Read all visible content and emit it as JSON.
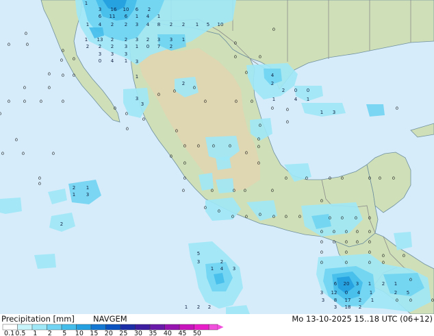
{
  "map": {
    "colors": {
      "sea": "#d6ecfa",
      "land": "#cfe0b8",
      "highland": "#e2d4b0",
      "border": "#8a8a8a",
      "coast": "#6f8f9f"
    },
    "cell_values": [
      [
        "1",
        "3",
        "16",
        "10",
        "6",
        "2"
      ],
      [
        "6",
        "11",
        "6",
        "1",
        "4",
        "1"
      ],
      [
        "1",
        "4",
        "2",
        "2",
        "3",
        "4",
        "8",
        "2",
        "2",
        "1",
        "5",
        "10"
      ],
      [
        "1",
        "13",
        "2",
        "2",
        "3",
        "2",
        "3",
        "3",
        "1"
      ],
      [
        "2",
        "2",
        "2",
        "3",
        "1",
        "0",
        "7",
        "2"
      ],
      [
        "3",
        "3",
        "3"
      ],
      [
        "0",
        "4",
        "1",
        "3"
      ],
      [
        "1",
        "2"
      ],
      [
        "3",
        "3"
      ],
      [
        "4",
        "2",
        "2",
        "0",
        "0"
      ],
      [
        "1",
        "4",
        "1",
        "1",
        "3"
      ],
      [
        "2",
        "1"
      ],
      [
        "1",
        "3",
        "2"
      ],
      [
        "1",
        "4",
        "3"
      ],
      [
        "3",
        "2",
        "5"
      ],
      [
        "6",
        "20",
        "3",
        "1",
        "2",
        "1"
      ],
      [
        "3",
        "12",
        "0",
        "4",
        "1",
        "2",
        "5"
      ],
      [
        "3",
        "8",
        "17",
        "2",
        "1"
      ],
      [
        "3",
        "18",
        "2"
      ],
      [
        "1",
        "2",
        "2"
      ]
    ]
  },
  "legend": {
    "title": "Precipitation [mm]",
    "model": "NAVGEM",
    "valid_time": "Mo 13-10-2025 15..18 UTC (06+12)",
    "levels": [
      "0.1",
      "0.5",
      "1",
      "2",
      "5",
      "10",
      "15",
      "20",
      "25",
      "30",
      "35",
      "40",
      "45",
      "50"
    ],
    "colors": [
      "#ffffff",
      "#c8f4fb",
      "#9ee8f7",
      "#70d4f2",
      "#45bdeb",
      "#249fe0",
      "#1478d2",
      "#0a52c0",
      "#1b2ea8",
      "#3e1ea0",
      "#6a1aa8",
      "#9814b0",
      "#c814bc",
      "#e81ec8",
      "#f050dc"
    ]
  }
}
